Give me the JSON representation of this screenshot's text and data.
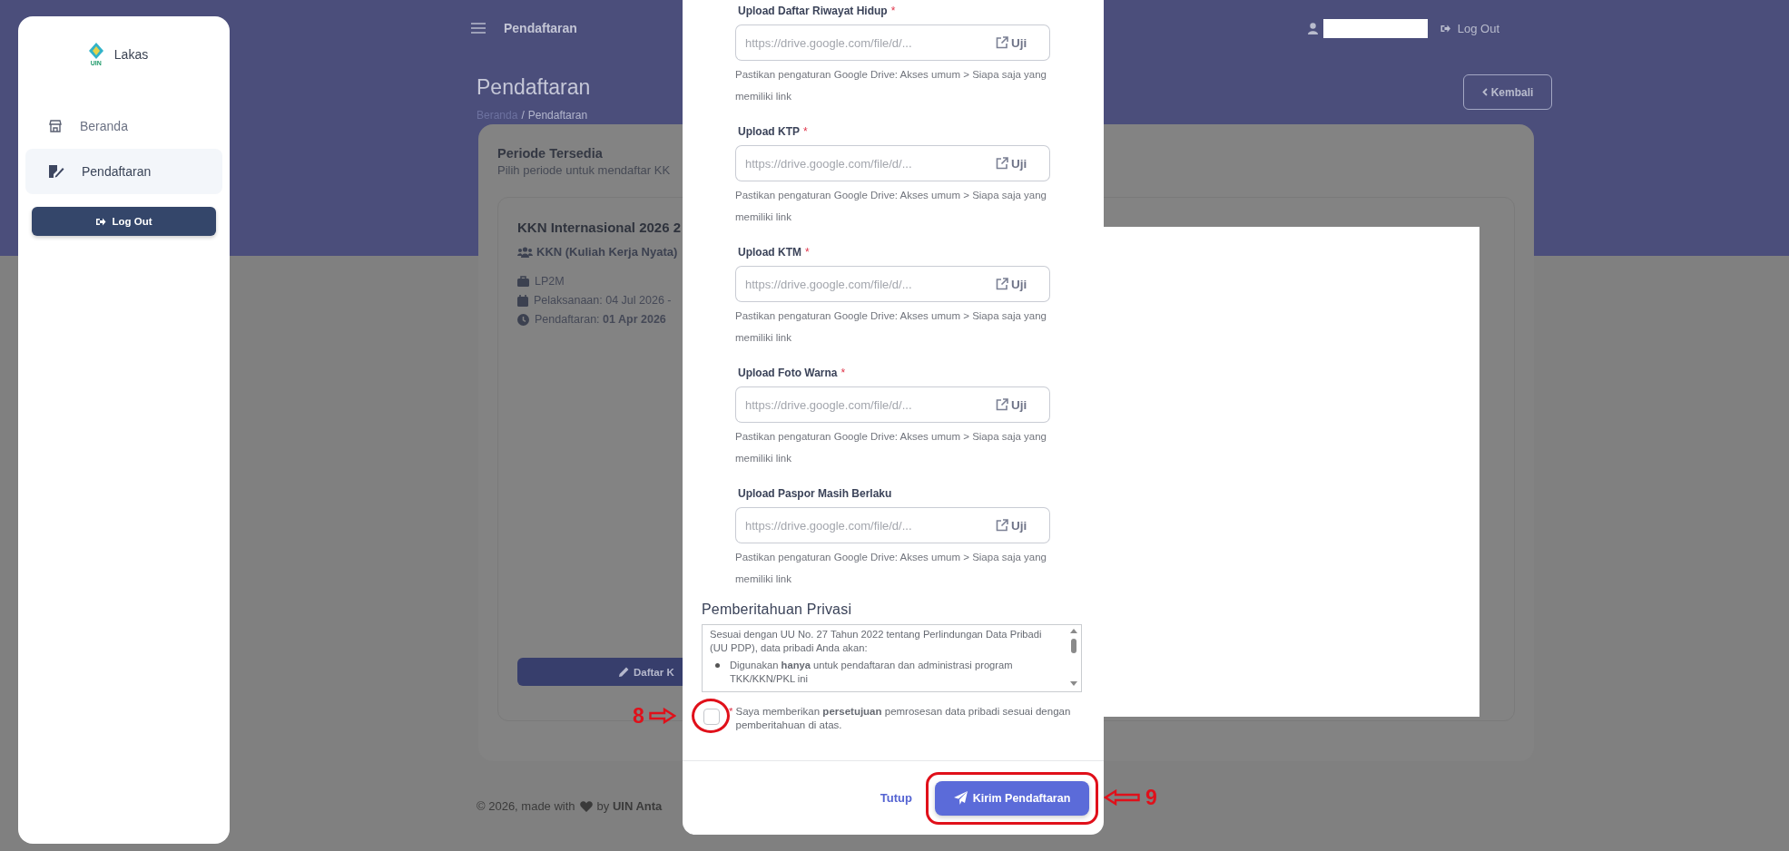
{
  "sidebar": {
    "logo": {
      "name": "Lakas",
      "mark": "UIN"
    },
    "items": [
      {
        "label": "Beranda",
        "selected": false
      },
      {
        "label": "Pendaftaran",
        "selected": true
      }
    ],
    "logout_button": "Log Out"
  },
  "topbar": {
    "title": "Pendaftaran",
    "logout": "Log Out"
  },
  "page_header": {
    "title": "Pendaftaran",
    "breadcrumb": [
      "Beranda",
      "Pendaftaran"
    ],
    "separator": "/",
    "back_button": "Kembali"
  },
  "periods_panel": {
    "title": "Periode Tersedia",
    "subtitle": "Pilih periode untuk mendaftar KK",
    "card": {
      "title": "KKN Internasional 2026 2",
      "type": "KKN (Kuliah Kerja Nyata)",
      "details": [
        {
          "kind": "unit",
          "text": "LP2M"
        },
        {
          "kind": "schedule",
          "text": "Pelaksanaan: 04 Jul 2026 -"
        },
        {
          "kind": "registration",
          "text": "Pendaftaran: **01 Apr 2026**"
        }
      ],
      "button": "Daftar K"
    }
  },
  "footer": {
    "before": "© 2026, made with",
    "after": "by **UIN Anta**"
  },
  "modal": {
    "fields": [
      {
        "label": "Upload Daftar Riwayat Hidup",
        "required_mark": "*",
        "placeholder": "https://drive.google.com/file/d/...",
        "button": "Uji",
        "help": "Pastikan pengaturan Google Drive: Akses umum > Siapa saja yang memiliki link"
      },
      {
        "label": "Upload KTP",
        "required_mark": "*",
        "placeholder": "https://drive.google.com/file/d/...",
        "button": "Uji",
        "help": "Pastikan pengaturan Google Drive: Akses umum > Siapa saja yang memiliki link"
      },
      {
        "label": "Upload KTM",
        "required_mark": "*",
        "placeholder": "https://drive.google.com/file/d/...",
        "button": "Uji",
        "help": "Pastikan pengaturan Google Drive: Akses umum > Siapa saja yang memiliki link"
      },
      {
        "label": "Upload Foto Warna",
        "required_mark": "*",
        "placeholder": "https://drive.google.com/file/d/...",
        "button": "Uji",
        "help": "Pastikan pengaturan Google Drive: Akses umum > Siapa saja yang memiliki link"
      },
      {
        "label": "Upload Paspor Masih Berlaku",
        "placeholder": "https://drive.google.com/file/d/...",
        "button": "Uji",
        "help": "Pastikan pengaturan Google Drive: Akses umum > Siapa saja yang memiliki link"
      }
    ],
    "privacy": {
      "title": "Pemberitahuan Privasi",
      "intro": "Sesuai dengan UU No. 27 Tahun 2022 tentang Perlindungan Data Pribadi (UU PDP), data pribadi Anda akan:",
      "bullets": [
        "Digunakan **hanya** untuk pendaftaran dan administrasi program TKK/KKN/PKL ini"
      ]
    },
    "consent": {
      "required_mark": "*",
      "text": "Saya memberikan **persetujuan** pemrosesan data pribadi sesuai dengan pemberitahuan di atas.",
      "checked": false
    },
    "buttons": [
      {
        "kind": "link",
        "label": "Tutup"
      },
      {
        "kind": "primary",
        "label": "Kirim Pendaftaran"
      }
    ]
  },
  "annotations": [
    {
      "kind": "circle",
      "label": "8"
    },
    {
      "kind": "box",
      "label": "9"
    }
  ]
}
